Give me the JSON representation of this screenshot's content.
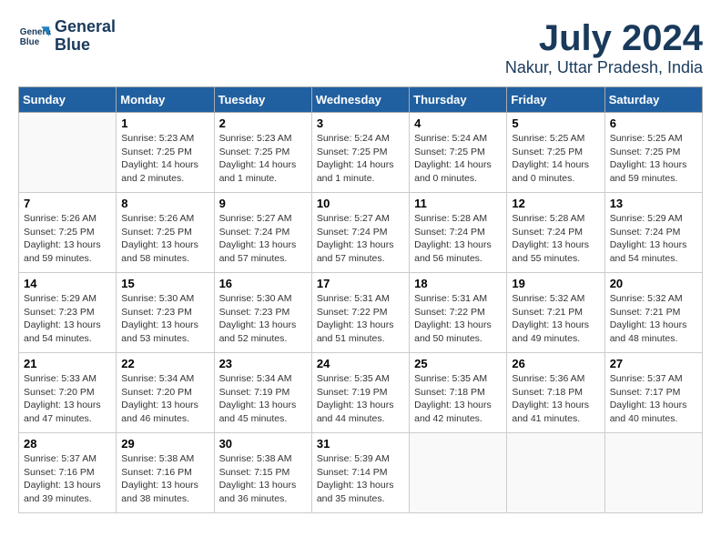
{
  "header": {
    "logo_line1": "General",
    "logo_line2": "Blue",
    "month_title": "July 2024",
    "location": "Nakur, Uttar Pradesh, India"
  },
  "weekdays": [
    "Sunday",
    "Monday",
    "Tuesday",
    "Wednesday",
    "Thursday",
    "Friday",
    "Saturday"
  ],
  "weeks": [
    [
      {
        "day": "",
        "info": ""
      },
      {
        "day": "1",
        "info": "Sunrise: 5:23 AM\nSunset: 7:25 PM\nDaylight: 14 hours\nand 2 minutes."
      },
      {
        "day": "2",
        "info": "Sunrise: 5:23 AM\nSunset: 7:25 PM\nDaylight: 14 hours\nand 1 minute."
      },
      {
        "day": "3",
        "info": "Sunrise: 5:24 AM\nSunset: 7:25 PM\nDaylight: 14 hours\nand 1 minute."
      },
      {
        "day": "4",
        "info": "Sunrise: 5:24 AM\nSunset: 7:25 PM\nDaylight: 14 hours\nand 0 minutes."
      },
      {
        "day": "5",
        "info": "Sunrise: 5:25 AM\nSunset: 7:25 PM\nDaylight: 14 hours\nand 0 minutes."
      },
      {
        "day": "6",
        "info": "Sunrise: 5:25 AM\nSunset: 7:25 PM\nDaylight: 13 hours\nand 59 minutes."
      }
    ],
    [
      {
        "day": "7",
        "info": "Sunrise: 5:26 AM\nSunset: 7:25 PM\nDaylight: 13 hours\nand 59 minutes."
      },
      {
        "day": "8",
        "info": "Sunrise: 5:26 AM\nSunset: 7:25 PM\nDaylight: 13 hours\nand 58 minutes."
      },
      {
        "day": "9",
        "info": "Sunrise: 5:27 AM\nSunset: 7:24 PM\nDaylight: 13 hours\nand 57 minutes."
      },
      {
        "day": "10",
        "info": "Sunrise: 5:27 AM\nSunset: 7:24 PM\nDaylight: 13 hours\nand 57 minutes."
      },
      {
        "day": "11",
        "info": "Sunrise: 5:28 AM\nSunset: 7:24 PM\nDaylight: 13 hours\nand 56 minutes."
      },
      {
        "day": "12",
        "info": "Sunrise: 5:28 AM\nSunset: 7:24 PM\nDaylight: 13 hours\nand 55 minutes."
      },
      {
        "day": "13",
        "info": "Sunrise: 5:29 AM\nSunset: 7:24 PM\nDaylight: 13 hours\nand 54 minutes."
      }
    ],
    [
      {
        "day": "14",
        "info": "Sunrise: 5:29 AM\nSunset: 7:23 PM\nDaylight: 13 hours\nand 54 minutes."
      },
      {
        "day": "15",
        "info": "Sunrise: 5:30 AM\nSunset: 7:23 PM\nDaylight: 13 hours\nand 53 minutes."
      },
      {
        "day": "16",
        "info": "Sunrise: 5:30 AM\nSunset: 7:23 PM\nDaylight: 13 hours\nand 52 minutes."
      },
      {
        "day": "17",
        "info": "Sunrise: 5:31 AM\nSunset: 7:22 PM\nDaylight: 13 hours\nand 51 minutes."
      },
      {
        "day": "18",
        "info": "Sunrise: 5:31 AM\nSunset: 7:22 PM\nDaylight: 13 hours\nand 50 minutes."
      },
      {
        "day": "19",
        "info": "Sunrise: 5:32 AM\nSunset: 7:21 PM\nDaylight: 13 hours\nand 49 minutes."
      },
      {
        "day": "20",
        "info": "Sunrise: 5:32 AM\nSunset: 7:21 PM\nDaylight: 13 hours\nand 48 minutes."
      }
    ],
    [
      {
        "day": "21",
        "info": "Sunrise: 5:33 AM\nSunset: 7:20 PM\nDaylight: 13 hours\nand 47 minutes."
      },
      {
        "day": "22",
        "info": "Sunrise: 5:34 AM\nSunset: 7:20 PM\nDaylight: 13 hours\nand 46 minutes."
      },
      {
        "day": "23",
        "info": "Sunrise: 5:34 AM\nSunset: 7:19 PM\nDaylight: 13 hours\nand 45 minutes."
      },
      {
        "day": "24",
        "info": "Sunrise: 5:35 AM\nSunset: 7:19 PM\nDaylight: 13 hours\nand 44 minutes."
      },
      {
        "day": "25",
        "info": "Sunrise: 5:35 AM\nSunset: 7:18 PM\nDaylight: 13 hours\nand 42 minutes."
      },
      {
        "day": "26",
        "info": "Sunrise: 5:36 AM\nSunset: 7:18 PM\nDaylight: 13 hours\nand 41 minutes."
      },
      {
        "day": "27",
        "info": "Sunrise: 5:37 AM\nSunset: 7:17 PM\nDaylight: 13 hours\nand 40 minutes."
      }
    ],
    [
      {
        "day": "28",
        "info": "Sunrise: 5:37 AM\nSunset: 7:16 PM\nDaylight: 13 hours\nand 39 minutes."
      },
      {
        "day": "29",
        "info": "Sunrise: 5:38 AM\nSunset: 7:16 PM\nDaylight: 13 hours\nand 38 minutes."
      },
      {
        "day": "30",
        "info": "Sunrise: 5:38 AM\nSunset: 7:15 PM\nDaylight: 13 hours\nand 36 minutes."
      },
      {
        "day": "31",
        "info": "Sunrise: 5:39 AM\nSunset: 7:14 PM\nDaylight: 13 hours\nand 35 minutes."
      },
      {
        "day": "",
        "info": ""
      },
      {
        "day": "",
        "info": ""
      },
      {
        "day": "",
        "info": ""
      }
    ]
  ]
}
